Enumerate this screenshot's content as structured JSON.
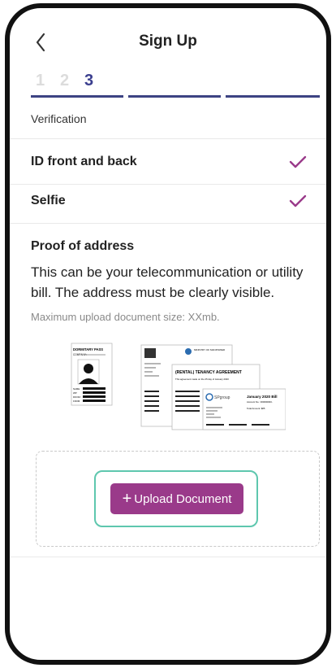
{
  "header": {
    "title": "Sign Up",
    "back_icon": "chevron-left-icon"
  },
  "steps": {
    "items": [
      "1",
      "2",
      "3"
    ],
    "current": 3,
    "segments": 3,
    "bar_color": "#3d4383",
    "active_color": "#3b3f8f"
  },
  "section": {
    "label": "Verification"
  },
  "verification_items": [
    {
      "label": "ID front and back",
      "status_icon": "check-icon",
      "complete": true
    },
    {
      "label": "Selfie",
      "status_icon": "check-icon",
      "complete": true
    }
  ],
  "proof": {
    "title": "Proof of address",
    "description": "This can be your telecommunication or utility bill. The address must be clearly visible.",
    "max_size": "Maximum upload document size: XXmb."
  },
  "illustration": {
    "pass_title": "DORMITARY PASS",
    "pass_company": "COMPANY:",
    "pass_fields": [
      "NAME:",
      "WP:",
      "ROOM:",
      "FROM:"
    ],
    "ministry": "MINISTRY OF MANPOWER",
    "agreement_title": "(RENTAL) TENANCY AGREEMENT",
    "agreement_line": "This agreement made on the 25 day of January 2020",
    "doc_lines": [
      "XXXXXXXXXX",
      "XXXXXXX",
      "XXXXX",
      "XXXXXXXXX"
    ],
    "bill_brand": "SPgroup",
    "bill_title": "January 2020 Bill",
    "bill_account": "Account No.: 000000000-",
    "bill_amount": "Total Amount: $85",
    "bill_lines": [
      "XXXXXXXXXX",
      "XXXXXXX",
      "XXXXX",
      "XXXXXXXXX"
    ]
  },
  "upload": {
    "label": "Upload Document",
    "plus": "+",
    "button_color": "#9a3a8a",
    "focus_color": "#5ec7ae"
  },
  "colors": {
    "check": "#9a3a8a"
  }
}
